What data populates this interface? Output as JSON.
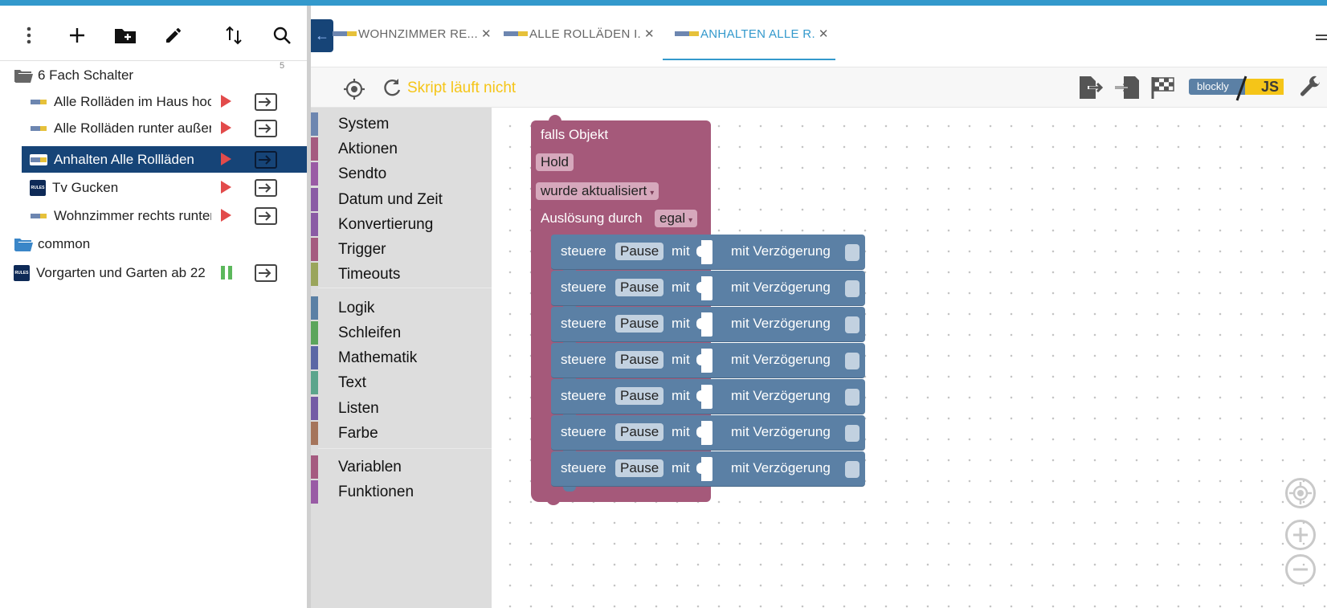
{
  "tree": {
    "items": [
      {
        "type": "folder",
        "label": "6 Fach Schalter",
        "count": "5"
      },
      {
        "type": "blockly",
        "label": "Alle Rolläden im Haus hoch",
        "running": true
      },
      {
        "type": "blockly",
        "label": "Alle Rolläden runter außer",
        "running": true
      },
      {
        "type": "blockly",
        "label": "Anhalten Alle Rollläden",
        "running": true,
        "selected": true
      },
      {
        "type": "rules",
        "label": "Tv Gucken",
        "running": true
      },
      {
        "type": "blockly",
        "label": "Wohnzimmer rechts runter",
        "running": true
      },
      {
        "type": "folder",
        "label": "common"
      },
      {
        "type": "rules",
        "label": "Vorgarten und Garten ab 22",
        "running": false
      }
    ]
  },
  "tabs": [
    {
      "label": "WOHNZIMMER RE...",
      "active": false
    },
    {
      "label": "ALLE ROLLÄDEN I.",
      "active": false
    },
    {
      "label": "ANHALTEN ALLE R.",
      "active": true
    }
  ],
  "toolbar": {
    "status": "Skript läuft nicht",
    "mode_blockly": "blockly",
    "mode_js": "JS"
  },
  "toolbox": {
    "categories": [
      {
        "label": "System",
        "color": "#6d86b0"
      },
      {
        "label": "Aktionen",
        "color": "#a55b80"
      },
      {
        "label": "Sendto",
        "color": "#9a5ba5"
      },
      {
        "label": "Datum und Zeit",
        "color": "#8a5ba5"
      },
      {
        "label": "Konvertierung",
        "color": "#8a5ba5"
      },
      {
        "label": "Trigger",
        "color": "#a55b80"
      },
      {
        "label": "Timeouts",
        "color": "#9aa55b"
      },
      {
        "label": "Logik",
        "color": "#5b80a5"
      },
      {
        "label": "Schleifen",
        "color": "#5ba55b"
      },
      {
        "label": "Mathematik",
        "color": "#5b67a5"
      },
      {
        "label": "Text",
        "color": "#5ba58c"
      },
      {
        "label": "Listen",
        "color": "#745ba5"
      },
      {
        "label": "Farbe",
        "color": "#a5745b"
      },
      {
        "label": "Variablen",
        "color": "#a55b80"
      },
      {
        "label": "Funktionen",
        "color": "#995ba5"
      }
    ]
  },
  "blocks": {
    "event": {
      "title": "falls Objekt",
      "object": "Hold",
      "condition": "wurde aktualisiert",
      "trigger_label": "Auslösung durch",
      "trigger_value": "egal"
    },
    "control": [
      {
        "label": "steuere",
        "object": "Pause",
        "with": "mit",
        "delay": "mit Verzögerung"
      },
      {
        "label": "steuere",
        "object": "Pause",
        "with": "mit",
        "delay": "mit Verzögerung"
      },
      {
        "label": "steuere",
        "object": "Pause",
        "with": "mit",
        "delay": "mit Verzögerung"
      },
      {
        "label": "steuere",
        "object": "Pause",
        "with": "mit",
        "delay": "mit Verzögerung"
      },
      {
        "label": "steuere",
        "object": "Pause",
        "with": "mit",
        "delay": "mit Verzögerung"
      },
      {
        "label": "steuere",
        "object": "Pause",
        "with": "mit",
        "delay": "mit Verzögerung"
      },
      {
        "label": "steuere",
        "object": "Pause",
        "with": "mit",
        "delay": "mit Verzögerung"
      }
    ]
  }
}
